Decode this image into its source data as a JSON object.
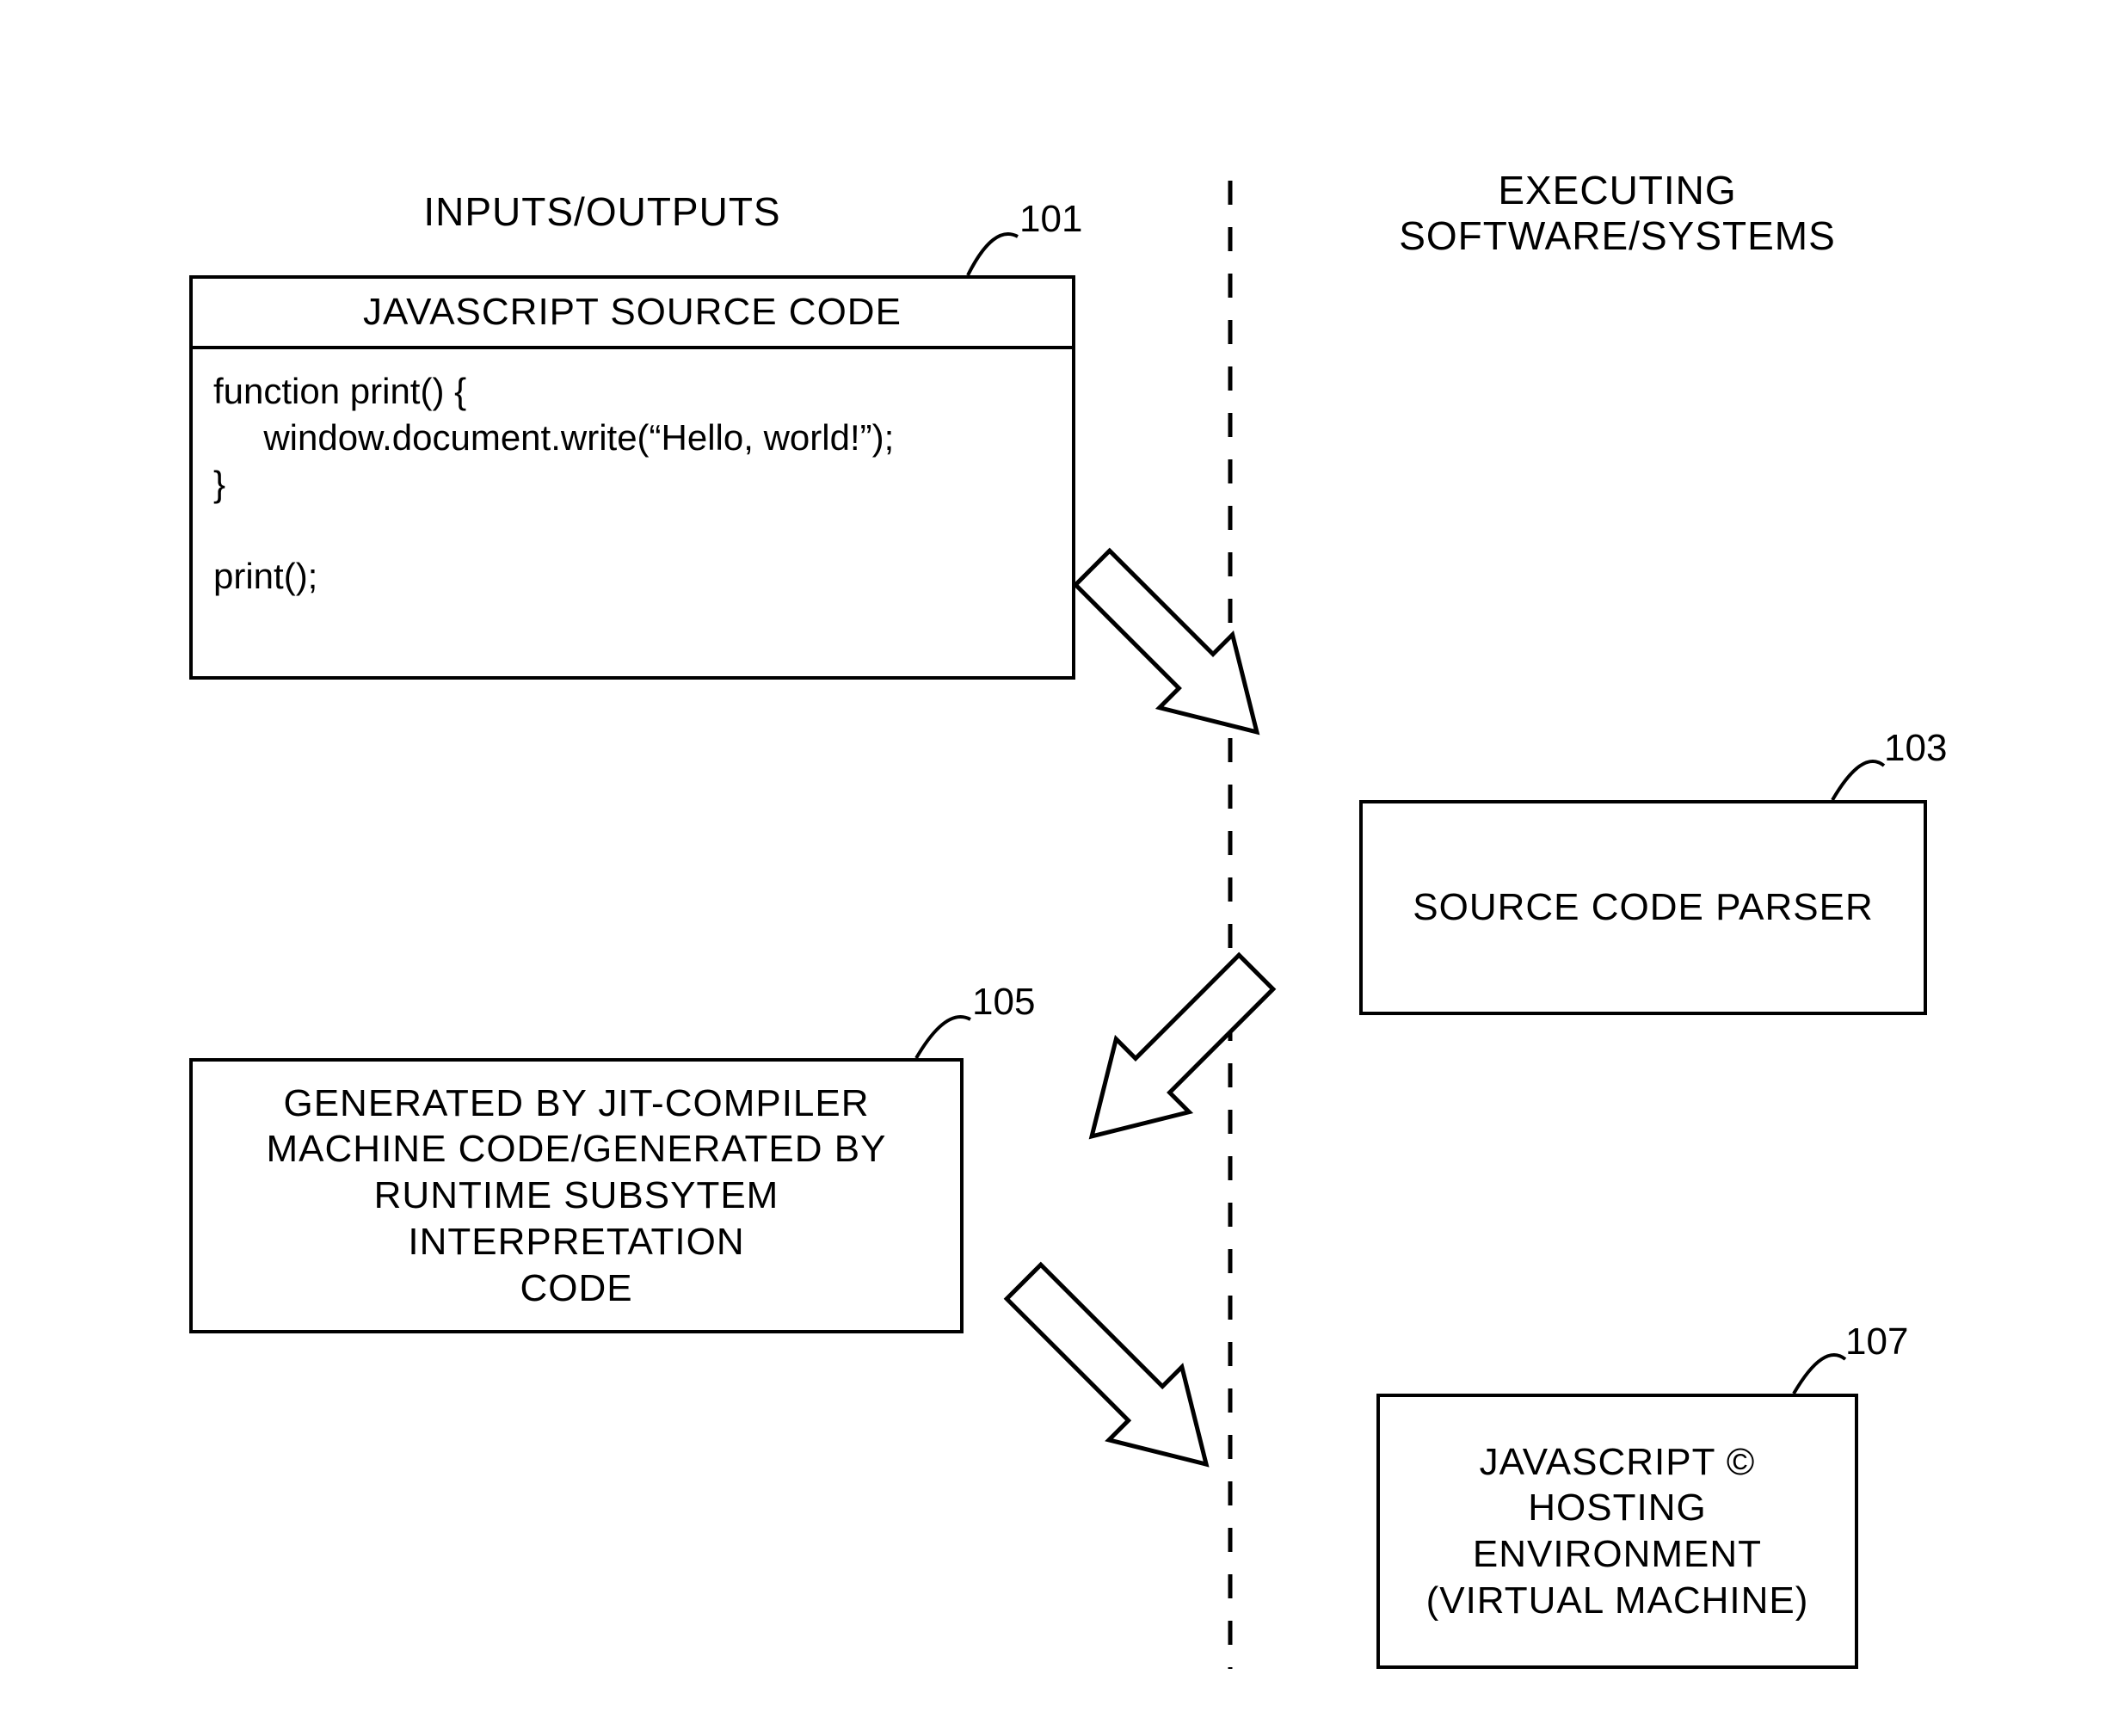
{
  "headings": {
    "left": "INPUTS/OUTPUTS",
    "right": "EXECUTING\nSOFTWARE/SYSTEMS"
  },
  "boxes": {
    "b101": {
      "ref": "101",
      "title": "JAVASCRIPT SOURCE CODE",
      "code": "function print() {\n     window.document.write(“Hello, world!”);\n}\n\nprint();"
    },
    "b103": {
      "ref": "103",
      "label": "SOURCE CODE PARSER"
    },
    "b105": {
      "ref": "105",
      "label": "GENERATED BY JIT-COMPILER\nMACHINE CODE/GENERATED BY\nRUNTIME SUBSYTEM INTERPRETATION\nCODE"
    },
    "b107": {
      "ref": "107",
      "label": "JAVASCRIPT ©\nHOSTING\nENVIRONMENT\n(VIRTUAL MACHINE)"
    }
  }
}
